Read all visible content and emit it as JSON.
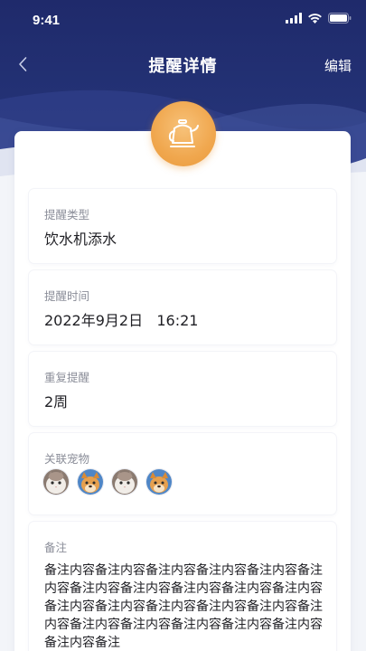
{
  "status_bar": {
    "time": "9:41",
    "icons": [
      "signal-icon",
      "wifi-icon",
      "battery-icon"
    ]
  },
  "nav": {
    "back_icon": "chevron-left-icon",
    "title": "提醒详情",
    "edit_label": "编辑"
  },
  "badge": {
    "icon": "kettle-icon",
    "color": "#f0a74e"
  },
  "type_section": {
    "label": "提醒类型",
    "value": "饮水机添水"
  },
  "time_section": {
    "label": "提醒时间",
    "value": "2022年9月2日   16:21"
  },
  "repeat_section": {
    "label": "重复提醒",
    "value": "2周"
  },
  "pets_section": {
    "label": "关联宠物",
    "pets": [
      "cat-avatar",
      "dog-avatar",
      "cat-avatar",
      "dog-avatar"
    ]
  },
  "notes_section": {
    "label": "备注",
    "value": "备注内容备注内容备注内容备注内容备注内容备注内容备注内容备注内容备注内容备注内容备注内容备注内容备注内容备注内容备注内容备注内容备注内容备注内容备注内容备注内容备注内容备注内容备注内容备注"
  },
  "colors": {
    "header": "#243377",
    "background": "#f3f5f9",
    "accent": "#f0a74e",
    "label": "#8b8e99"
  }
}
